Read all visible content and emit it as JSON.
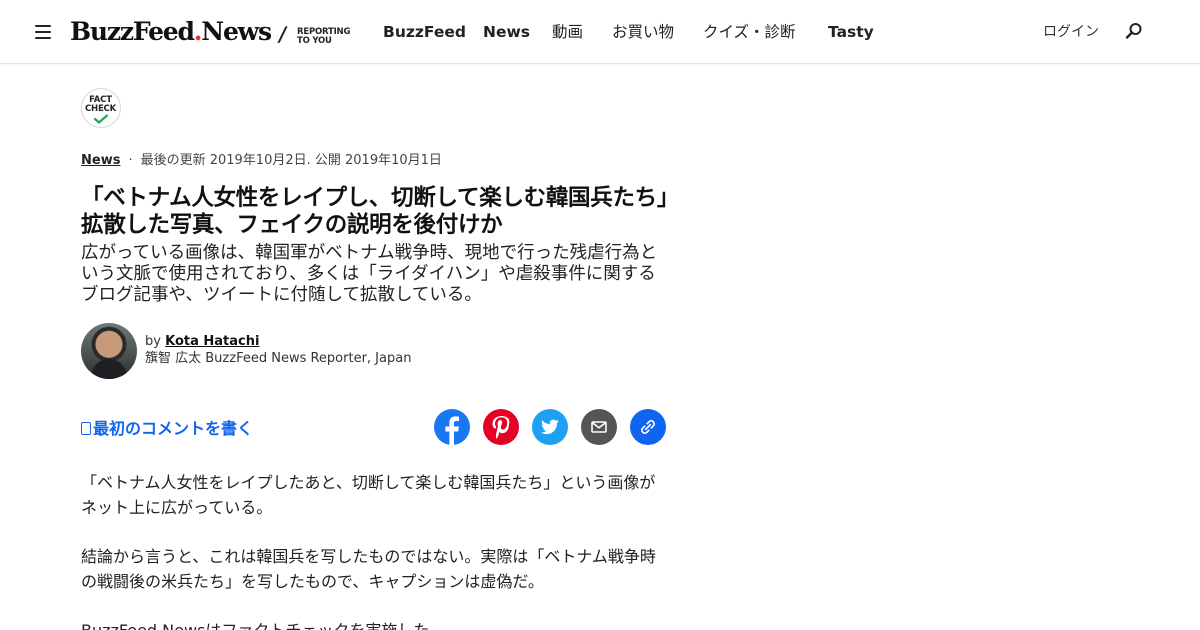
{
  "header": {
    "logo_main": "BuzzFeed",
    "logo_dot": ".",
    "logo_news": "News",
    "tagline_line1": "REPORTING",
    "tagline_line2": "TO YOU",
    "nav": [
      "BuzzFeed",
      "News",
      "動画",
      "お買い物",
      "クイズ・診断",
      "Tasty"
    ],
    "login": "ログイン"
  },
  "badge": {
    "line1": "FACT",
    "line2": "CHECK"
  },
  "meta": {
    "section": "News",
    "separator": "·",
    "dates": "最後の更新 2019年10月2日. 公開 2019年10月1日"
  },
  "article": {
    "headline": "「ベトナム人女性をレイプし、切断して楽しむ韓国兵たち」拡散した写真、フェイクの説明を後付けか",
    "dek": "広がっている画像は、韓国軍がベトナム戦争時、現地で行った残虐行為という文脈で使用されており、多くは「ライダイハン」や虐殺事件に関するブログ記事や、ツイートに付随して拡散している。",
    "paragraphs": [
      "「ベトナム人女性をレイプしたあと、切断して楽しむ韓国兵たち」という画像がネット上に広がっている。",
      "結論から言うと、これは韓国兵を写したものではない。実際は「ベトナム戦争時の戦闘後の米兵たち」を写したもので、キャプションは虚偽だ。",
      "BuzzFeed Newsはファクトチェックを実施した。"
    ]
  },
  "author": {
    "by": "by",
    "name": "Kota Hatachi",
    "title": "籏智 広太 BuzzFeed News Reporter, Japan"
  },
  "comments": {
    "label": "最初のコメントを書く"
  },
  "share": {
    "icons": [
      "facebook-icon",
      "pinterest-icon",
      "twitter-icon",
      "email-icon",
      "link-icon"
    ],
    "colors": {
      "facebook": "#1877f2",
      "pinterest": "#e60023",
      "twitter": "#1da1f2",
      "email": "#555555",
      "link": "#0f65ef"
    }
  },
  "colors": {
    "accent": "#0f65ef",
    "logo_dot": "#ee3322"
  }
}
